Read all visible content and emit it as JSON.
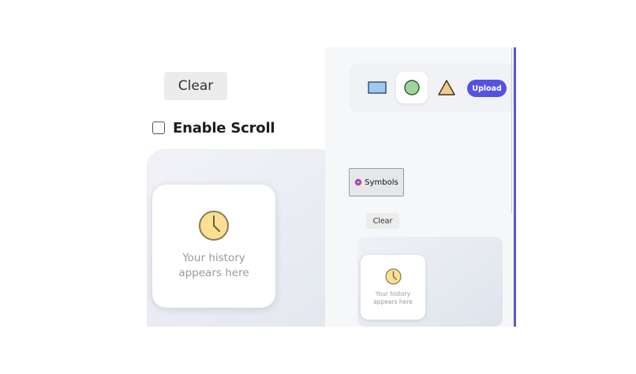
{
  "left_panel": {
    "clear_label": "Clear",
    "enable_scroll_label": "Enable Scroll",
    "enable_scroll_checked": false,
    "history_empty_text": "Your history appears here"
  },
  "right_panel": {
    "toolbar": {
      "tools": [
        {
          "name": "rectangle-icon",
          "fill": "#9fc9f0",
          "stroke": "#2a4d6e"
        },
        {
          "name": "circle-icon",
          "fill": "#9fd49a",
          "stroke": "#2f5a2e",
          "active": true
        },
        {
          "name": "triangle-icon",
          "fill": "#f6c98a",
          "stroke": "#3a3020"
        }
      ],
      "upload_label": "Upload"
    },
    "symbols_label": "Symbols",
    "clear_label": "Clear",
    "history_empty_text": "Your history appears here"
  },
  "colors": {
    "accent": "#5453e0",
    "divider": "#5b57c9",
    "clock_fill": "#fbdf92",
    "clock_stroke": "#8a7a55"
  }
}
